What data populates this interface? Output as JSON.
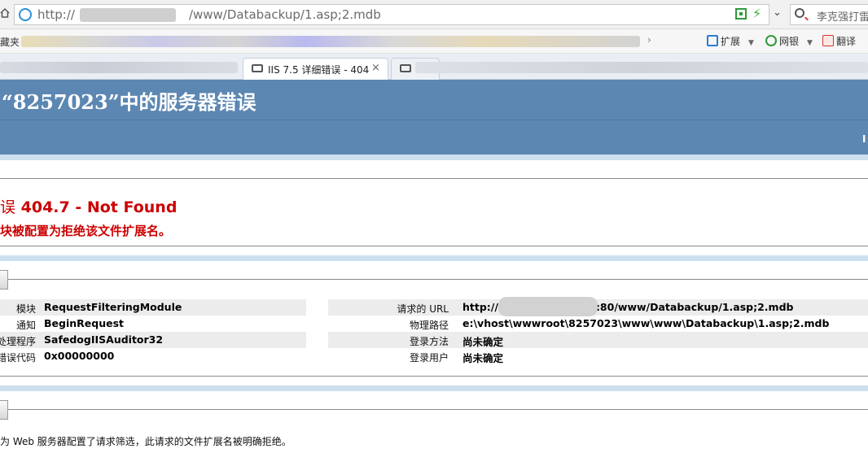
{
  "browser": {
    "address": {
      "url_prefix": "http://",
      "url_suffix": "/www/Databackup/1.asp;2.mdb"
    },
    "search": {
      "text": "李克强打雷"
    },
    "bookmarks": {
      "favorites_label": "藏夹",
      "tools": [
        {
          "label": "扩展",
          "icon": "extensions-icon",
          "color": "#2b7bd1"
        },
        {
          "label": "网银",
          "icon": "bank-icon",
          "color": "#2f9a3a"
        },
        {
          "label": "翻译",
          "icon": "translate-icon",
          "color": "#d0342c"
        }
      ]
    },
    "tabs": [
      {
        "title": "IIS 7.5 详细错误 - 404",
        "close": "×"
      }
    ]
  },
  "page": {
    "header_title": "“8257023”中的服务器错误",
    "header_right": "I",
    "error_prefix": "误",
    "error_title": "404.7 - Not Found",
    "error_subtitle": "块被配置为拒绝该文件扩展名。",
    "details_left": [
      {
        "label": "模块",
        "value": "RequestFilteringModule"
      },
      {
        "label": "通知",
        "value": "BeginRequest"
      },
      {
        "label": "处理程序",
        "value": "SafedogIISAuditor32"
      },
      {
        "label": "错误代码",
        "value": "0x00000000"
      }
    ],
    "details_right": [
      {
        "label": "请求的 URL",
        "value_prefix": "http://",
        "value": ":80/www/Databackup/1.asp;2.mdb"
      },
      {
        "label": "物理路径",
        "value": "e:\\vhost\\wwwroot\\8257023\\www\\www\\Databackup\\1.asp;2.mdb"
      },
      {
        "label": "登录方法",
        "value": "尚未确定"
      },
      {
        "label": "登录用户",
        "value": "尚未确定"
      }
    ],
    "footer": "为 Web 服务器配置了请求筛选，此请求的文件扩展名被明确拒绝。"
  },
  "colors": {
    "banner": "#5c87b2",
    "band": "#cde0ef",
    "error_red": "#cc0000"
  }
}
